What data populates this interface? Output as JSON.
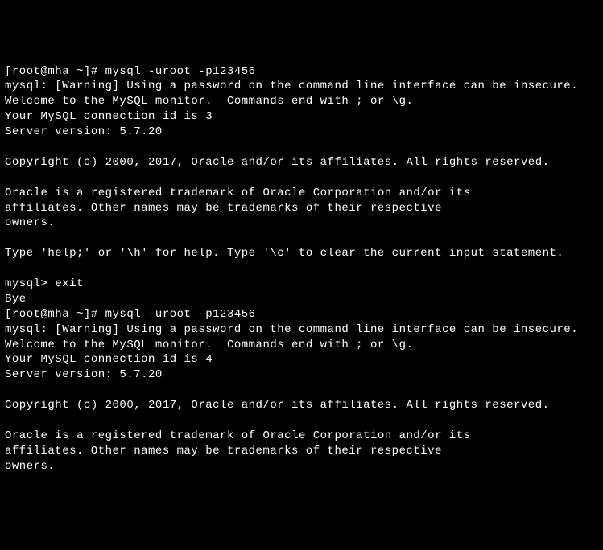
{
  "session1": {
    "prompt_prefix": "[root@mha ~]# ",
    "command": "mysql -uroot -p123456",
    "warning": "mysql: [Warning] Using a password on the command line interface can be insecure.",
    "welcome": "Welcome to the MySQL monitor.  Commands end with ; or \\g.",
    "connection_id": "Your MySQL connection id is 3",
    "server_version": "Server version: 5.7.20",
    "copyright": "Copyright (c) 2000, 2017, Oracle and/or its affiliates. All rights reserved.",
    "trademark1": "Oracle is a registered trademark of Oracle Corporation and/or its",
    "trademark2": "affiliates. Other names may be trademarks of their respective",
    "trademark3": "owners.",
    "help": "Type 'help;' or '\\h' for help. Type '\\c' to clear the current input statement.",
    "mysql_prompt_prefix": "mysql> ",
    "mysql_command": "exit",
    "bye": "Bye"
  },
  "session2": {
    "prompt_prefix": "[root@mha ~]# ",
    "command": "mysql -uroot -p123456",
    "warning": "mysql: [Warning] Using a password on the command line interface can be insecure.",
    "welcome": "Welcome to the MySQL monitor.  Commands end with ; or \\g.",
    "connection_id": "Your MySQL connection id is 4",
    "server_version": "Server version: 5.7.20",
    "copyright": "Copyright (c) 2000, 2017, Oracle and/or its affiliates. All rights reserved.",
    "trademark1": "Oracle is a registered trademark of Oracle Corporation and/or its",
    "trademark2": "affiliates. Other names may be trademarks of their respective",
    "trademark3": "owners."
  }
}
